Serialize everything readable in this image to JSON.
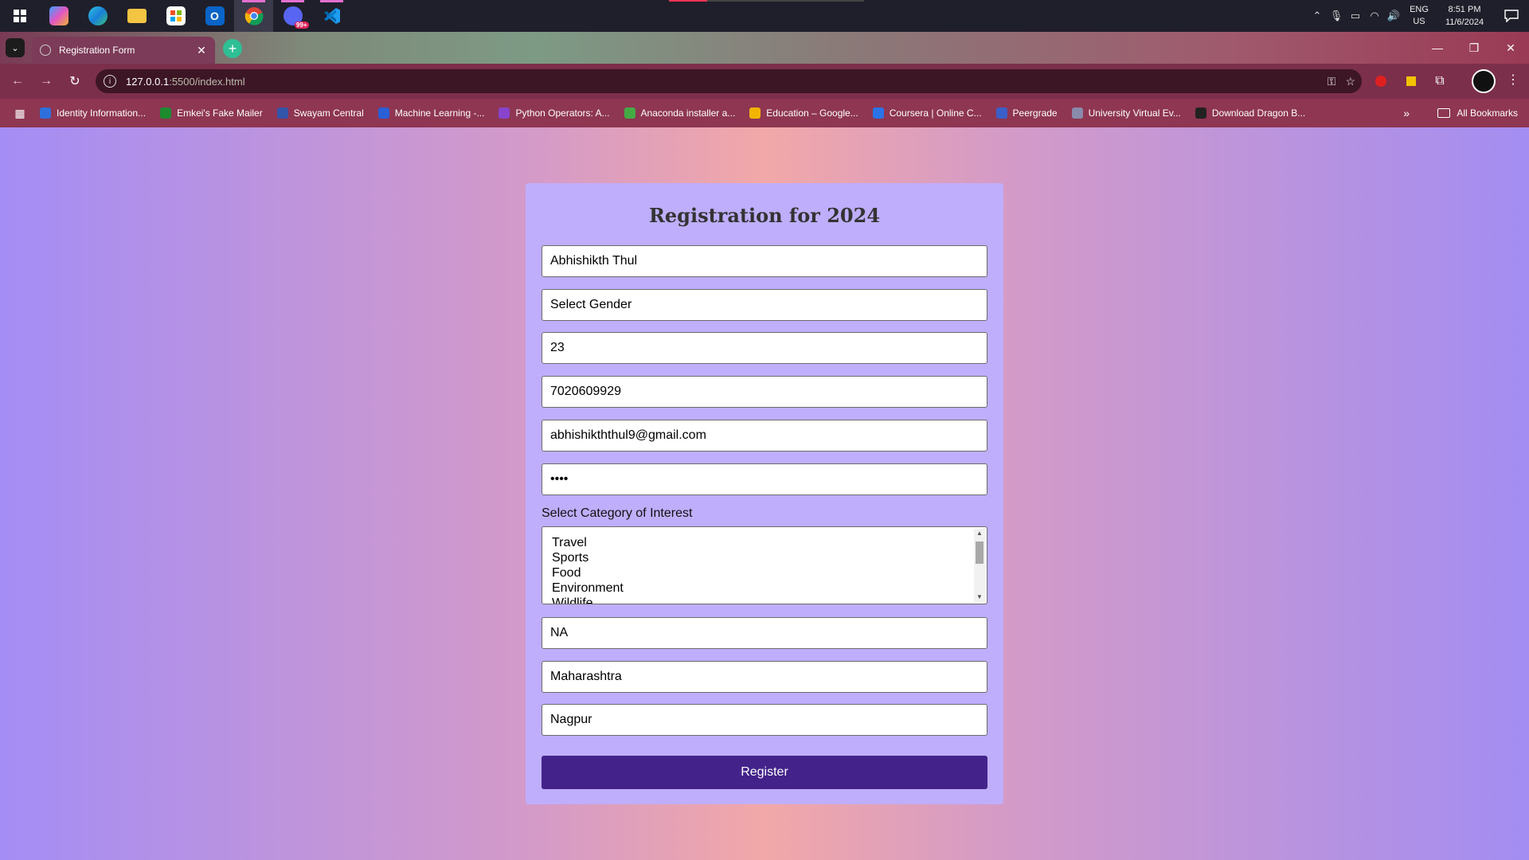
{
  "taskbar": {
    "apps": [
      "windows-start-icon",
      "copilot-icon",
      "edge-icon",
      "file-explorer-icon",
      "microsoft-store-icon",
      "outlook-icon",
      "chrome-icon",
      "discord-icon",
      "vscode-icon"
    ],
    "lang_top": "ENG",
    "lang_bottom": "US",
    "time": "8:51 PM",
    "date": "11/6/2024",
    "badge": "99+"
  },
  "browser": {
    "tab_title": "Registration Form",
    "url_host": "127.0.0.1",
    "url_path": ":5500/index.html",
    "bookmarks": [
      {
        "label": "Identity Information...",
        "color": "#2f6fdc"
      },
      {
        "label": "Emkei's Fake Mailer",
        "color": "#1d8a2e"
      },
      {
        "label": "Swayam Central",
        "color": "#3355aa"
      },
      {
        "label": "Machine Learning -...",
        "color": "#2a5fd6"
      },
      {
        "label": "Python Operators: A...",
        "color": "#8844cc"
      },
      {
        "label": "Anaconda installer a...",
        "color": "#44aa44"
      },
      {
        "label": "Education – Google...",
        "color": "#f2b400"
      },
      {
        "label": "Coursera | Online C...",
        "color": "#2a73e8"
      },
      {
        "label": "Peergrade",
        "color": "#3a5fc8"
      },
      {
        "label": "University Virtual Ev...",
        "color": "#8a8aaa"
      },
      {
        "label": "Download Dragon B...",
        "color": "#222222"
      }
    ],
    "all_bookmarks": "All Bookmarks"
  },
  "form": {
    "title": "Registration for 2024",
    "name": "Abhishikth Thul",
    "gender": "Select Gender",
    "age": "23",
    "phone": "7020609929",
    "email": "abhishikththul9@gmail.com",
    "password": "••••",
    "category_label": "Select Category of Interest",
    "categories": [
      "Travel",
      "Sports",
      "Food",
      "Environment",
      "Wildlife"
    ],
    "field_na": "NA",
    "state": "Maharashtra",
    "city": "Nagpur",
    "register_label": "Register"
  }
}
